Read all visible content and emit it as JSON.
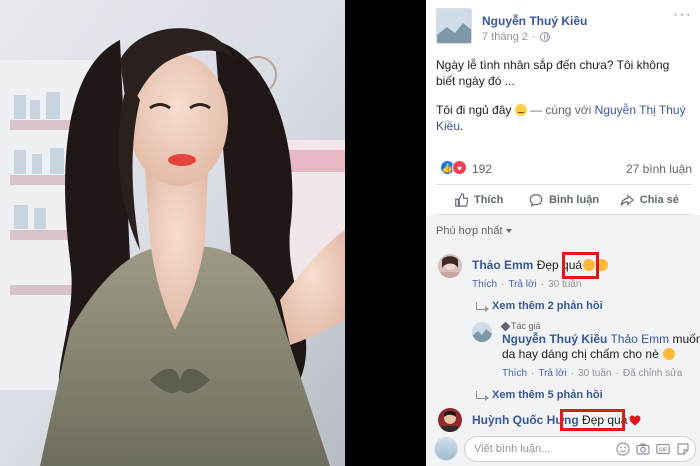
{
  "post": {
    "author": "Nguyễn Thuý Kiều",
    "date": "7 tháng 2",
    "text_line1": "Ngày lễ tình nhân sắp đến chưa? Tôi không biết ngày đó ...",
    "text_line2_prefix": "Tôi đi ngủ đây",
    "text_line2_with": "— cùng với",
    "tagged_person": "Nguyễn Thị Thuý Kiều",
    "text_line2_suffix": "."
  },
  "stats": {
    "reaction_count": "192",
    "comment_count": "27 bình luận"
  },
  "actions": {
    "like": "Thích",
    "comment": "Bình luận",
    "share": "Chia sẻ"
  },
  "sort_label": "Phù hợp nhất",
  "comments": [
    {
      "name": "Thảo Emm",
      "text": "Đẹp quá",
      "reply_label": "Thích",
      "reply_action": "Trả lời",
      "time": "30 tuần",
      "view_more": "Xem thêm 2 phản hồi"
    },
    {
      "author_tag": "Tác giả",
      "name": "Nguyễn Thuý Kiều",
      "mention": "Thảo Emm",
      "text_a": "muốn",
      "text_b": "da hay dáng chị chấm cho nè",
      "like_label": "Thích",
      "reply_action": "Trả lời",
      "time": "30 tuần",
      "edited": "Đã chỉnh sửa",
      "view_more": "Xem thêm 5 phản hồi"
    },
    {
      "name": "Huỳnh Quốc Hưng",
      "text": "Đẹp quá"
    }
  ],
  "compose": {
    "placeholder": "Viết bình luận..."
  },
  "colors": {
    "link": "#385898",
    "highlight": "#e11818",
    "like_blue": "#1877f2",
    "love_red": "#f33e58"
  }
}
